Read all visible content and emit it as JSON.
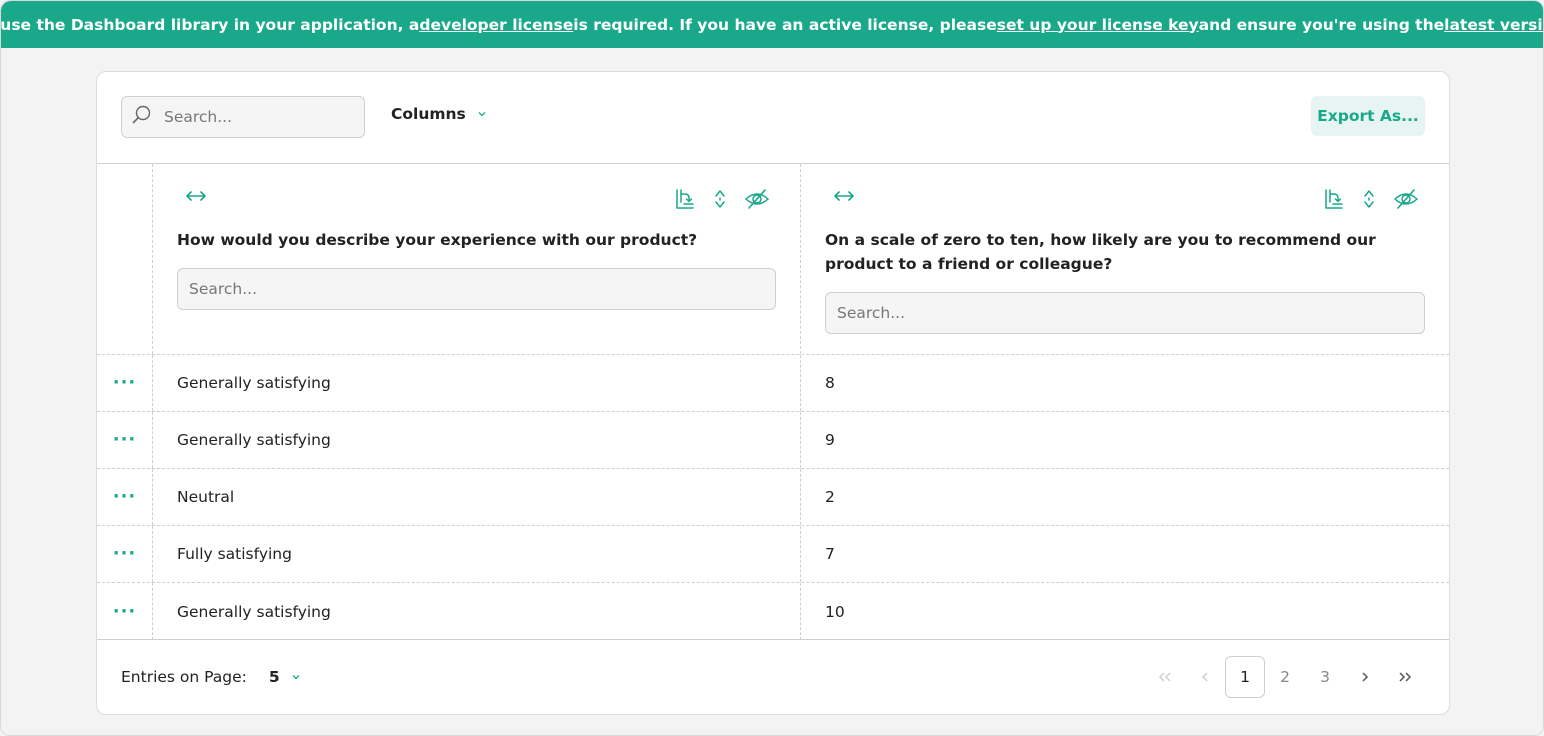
{
  "banner": {
    "part1": "To use the Dashboard library in your application, a ",
    "link1": "developer license",
    "part2": " is required. If you have an active license, please ",
    "link2": "set up your license key",
    "part3": " and ensure you're using the ",
    "link3": "latest version",
    "part4": "."
  },
  "toolbar": {
    "search_placeholder": "Search...",
    "columns_label": "Columns",
    "export_label": "Export As..."
  },
  "columns": [
    {
      "title": "How would you describe your experience with our product?",
      "search_placeholder": "Search..."
    },
    {
      "title": "On a scale of zero to ten, how likely are you to recommend our product to a friend or colleague?",
      "search_placeholder": "Search..."
    }
  ],
  "rows": [
    {
      "dots": "···",
      "c1": "Generally satisfying",
      "c2": "8"
    },
    {
      "dots": "···",
      "c1": "Generally satisfying",
      "c2": "9"
    },
    {
      "dots": "···",
      "c1": "Neutral",
      "c2": "2"
    },
    {
      "dots": "···",
      "c1": "Fully satisfying",
      "c2": "7"
    },
    {
      "dots": "···",
      "c1": "Generally satisfying",
      "c2": "10"
    }
  ],
  "footer": {
    "entries_label": "Entries on Page:",
    "entries_value": "5",
    "pages": [
      "1",
      "2",
      "3"
    ],
    "current_page": "1"
  },
  "colors": {
    "accent": "#19a88a",
    "accent_light": "#e6f5f1"
  },
  "icons": {
    "search": "search-icon",
    "resize": "resize-arrows-icon",
    "sort_column": "sort-column-icon",
    "sort_toggle": "sort-updown-icon",
    "hide": "eye-off-icon",
    "row_menu": "more-dots-icon"
  }
}
